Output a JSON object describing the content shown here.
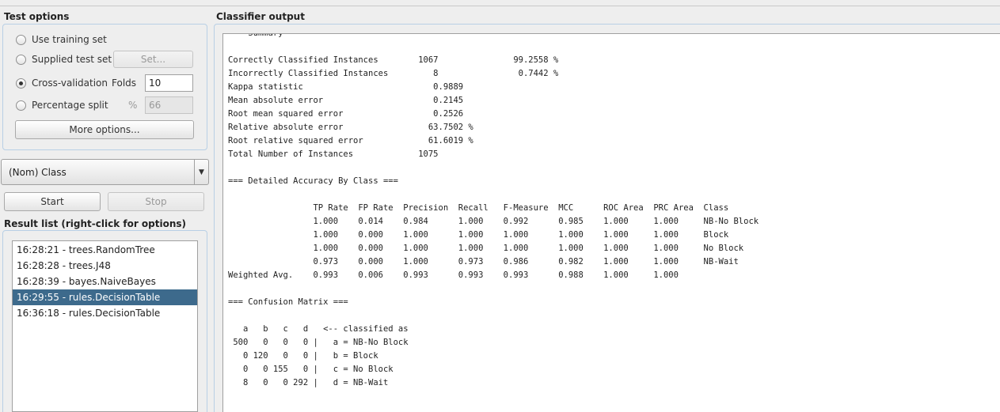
{
  "test_options": {
    "title": "Test options",
    "use_training_set": "Use training set",
    "supplied_test_set": "Supplied test set",
    "set_button": "Set...",
    "cross_validation": "Cross-validation",
    "folds_label": "Folds",
    "folds_value": "10",
    "percentage_split": "Percentage split",
    "percent_label": "%",
    "percent_value": "66",
    "more_options": "More options...",
    "selected": "cross_validation"
  },
  "class_select": {
    "value": "(Nom) Class"
  },
  "controls": {
    "start": "Start",
    "stop": "Stop"
  },
  "result_list": {
    "title": "Result list (right-click for options)",
    "items": [
      "16:28:21 - trees.RandomTree",
      "16:28:28 - trees.J48",
      "16:28:39 - bayes.NaiveBayes",
      "16:29:55 - rules.DecisionTable",
      "16:36:18 - rules.DecisionTable"
    ],
    "selected_index": 3
  },
  "classifier_output": {
    "title": "Classifier output",
    "text": "=== Summary ===\n\nCorrectly Classified Instances        1067               99.2558 %\nIncorrectly Classified Instances         8                0.7442 %\nKappa statistic                          0.9889\nMean absolute error                      0.2145\nRoot mean squared error                  0.2526\nRelative absolute error                 63.7502 %\nRoot relative squared error             61.6019 %\nTotal Number of Instances             1075     \n\n=== Detailed Accuracy By Class ===\n\n                 TP Rate  FP Rate  Precision  Recall   F-Measure  MCC      ROC Area  PRC Area  Class\n                 1.000    0.014    0.984      1.000    0.992      0.985    1.000     1.000     NB-No Block\n                 1.000    0.000    1.000      1.000    1.000      1.000    1.000     1.000     Block\n                 1.000    0.000    1.000      1.000    1.000      1.000    1.000     1.000     No Block\n                 0.973    0.000    1.000      0.973    0.986      0.982    1.000     1.000     NB-Wait\nWeighted Avg.    0.993    0.006    0.993      0.993    0.993      0.988    1.000     1.000     \n\n=== Confusion Matrix ===\n\n   a   b   c   d   <-- classified as\n 500   0   0   0 |   a = NB-No Block\n   0 120   0   0 |   b = Block\n   0   0 155   0 |   c = No Block\n   8   0   0 292 |   d = NB-Wait"
  }
}
